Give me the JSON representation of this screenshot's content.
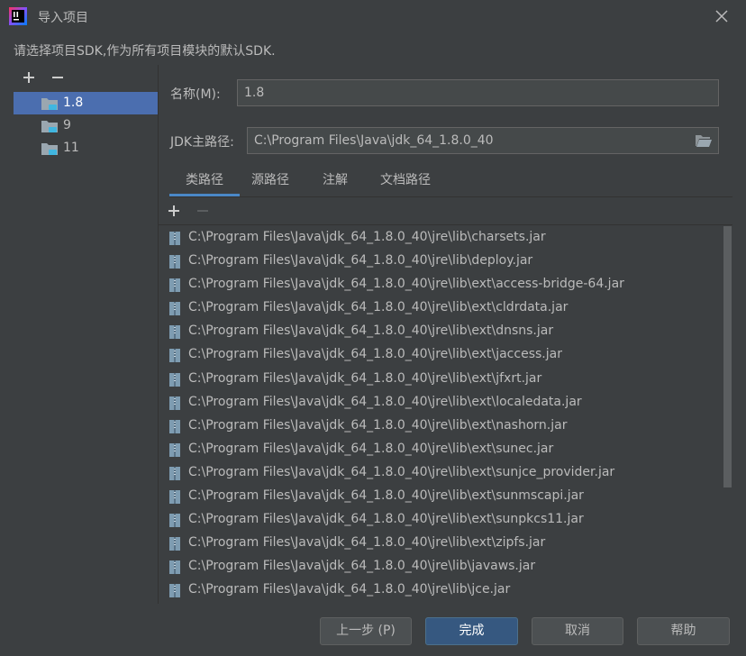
{
  "window": {
    "title": "导入项目",
    "description": "请选择项目SDK,作为所有项目模块的默认SDK."
  },
  "sdk_tree": {
    "items": [
      {
        "label": "1.8",
        "selected": true
      },
      {
        "label": "9",
        "selected": false
      },
      {
        "label": "11",
        "selected": false
      }
    ]
  },
  "form": {
    "name_label": "名称(M):",
    "name_value": "1.8",
    "jdk_label": "JDK主路径:",
    "jdk_value": "C:\\Program Files\\Java\\jdk_64_1.8.0_40"
  },
  "tabs": [
    {
      "label": "类路径",
      "active": true
    },
    {
      "label": "源路径",
      "active": false
    },
    {
      "label": "注解",
      "active": false
    },
    {
      "label": "文档路径",
      "active": false
    }
  ],
  "classpath": [
    "C:\\Program Files\\Java\\jdk_64_1.8.0_40\\jre\\lib\\charsets.jar",
    "C:\\Program Files\\Java\\jdk_64_1.8.0_40\\jre\\lib\\deploy.jar",
    "C:\\Program Files\\Java\\jdk_64_1.8.0_40\\jre\\lib\\ext\\access-bridge-64.jar",
    "C:\\Program Files\\Java\\jdk_64_1.8.0_40\\jre\\lib\\ext\\cldrdata.jar",
    "C:\\Program Files\\Java\\jdk_64_1.8.0_40\\jre\\lib\\ext\\dnsns.jar",
    "C:\\Program Files\\Java\\jdk_64_1.8.0_40\\jre\\lib\\ext\\jaccess.jar",
    "C:\\Program Files\\Java\\jdk_64_1.8.0_40\\jre\\lib\\ext\\jfxrt.jar",
    "C:\\Program Files\\Java\\jdk_64_1.8.0_40\\jre\\lib\\ext\\localedata.jar",
    "C:\\Program Files\\Java\\jdk_64_1.8.0_40\\jre\\lib\\ext\\nashorn.jar",
    "C:\\Program Files\\Java\\jdk_64_1.8.0_40\\jre\\lib\\ext\\sunec.jar",
    "C:\\Program Files\\Java\\jdk_64_1.8.0_40\\jre\\lib\\ext\\sunjce_provider.jar",
    "C:\\Program Files\\Java\\jdk_64_1.8.0_40\\jre\\lib\\ext\\sunmscapi.jar",
    "C:\\Program Files\\Java\\jdk_64_1.8.0_40\\jre\\lib\\ext\\sunpkcs11.jar",
    "C:\\Program Files\\Java\\jdk_64_1.8.0_40\\jre\\lib\\ext\\zipfs.jar",
    "C:\\Program Files\\Java\\jdk_64_1.8.0_40\\jre\\lib\\javaws.jar",
    "C:\\Program Files\\Java\\jdk_64_1.8.0_40\\jre\\lib\\jce.jar"
  ],
  "buttons": {
    "prev": "上一步 (P)",
    "finish": "完成",
    "cancel": "取消",
    "help": "帮助"
  },
  "icons": {
    "app": "intellij-logo-icon",
    "close": "close-icon",
    "add": "plus-icon",
    "remove": "minus-icon",
    "sdk": "folder-java-icon",
    "browse": "folder-open-icon",
    "jar": "jar-archive-icon"
  },
  "colors": {
    "background": "#3c3f41",
    "selection": "#4b6eaf",
    "primary_button": "#365880",
    "tab_underline": "#4a88c7"
  }
}
